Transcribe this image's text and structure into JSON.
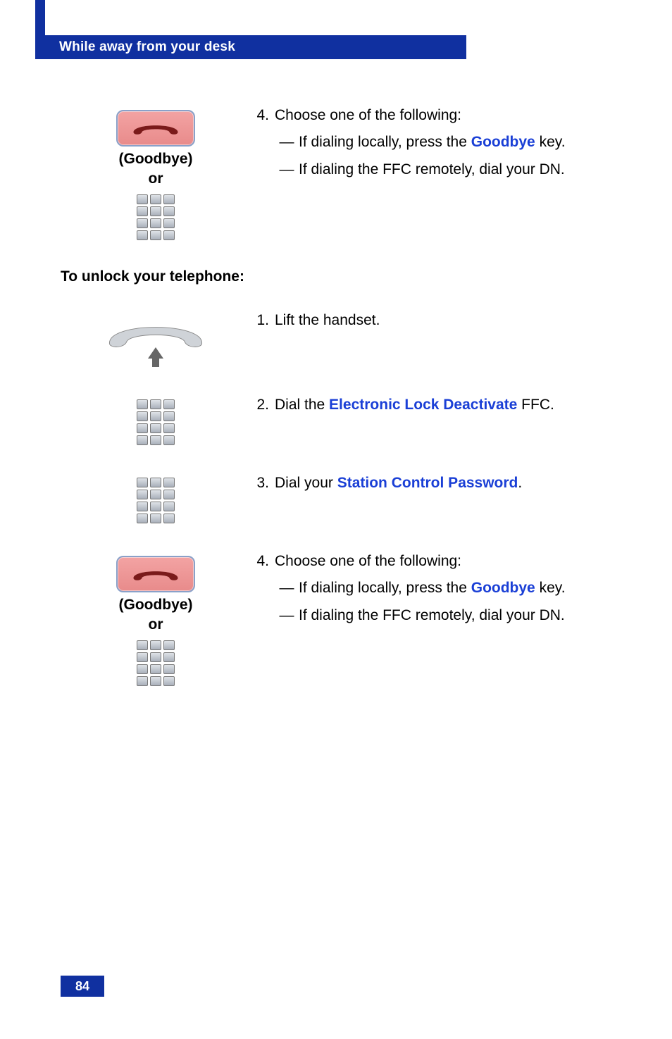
{
  "header": {
    "title": "While away from your desk"
  },
  "pageNumber": "84",
  "labels": {
    "goodbye": "(Goodbye)",
    "or": "or"
  },
  "blockA": {
    "num": "4.",
    "lead": "Choose one of the following:",
    "sub1_prefix": "If dialing locally, press the ",
    "sub1_blue": "Goodbye",
    "sub1_suffix": " key.",
    "sub2": "If dialing the FFC remotely, dial your DN."
  },
  "sectionTitle": "To unlock your telephone:",
  "step1": {
    "num": "1.",
    "text": "Lift the handset."
  },
  "step2": {
    "num": "2.",
    "prefix": "Dial the ",
    "blue": "Electronic Lock Deactivate",
    "suffix": " FFC."
  },
  "step3": {
    "num": "3.",
    "prefix": "Dial your ",
    "blue": "Station Control Password",
    "suffix": "."
  },
  "blockB": {
    "num": "4.",
    "lead": "Choose one of the following:",
    "sub1_prefix": "If dialing locally, press the ",
    "sub1_blue": "Goodbye",
    "sub1_suffix": " key.",
    "sub2": "If dialing the FFC remotely, dial your DN."
  }
}
